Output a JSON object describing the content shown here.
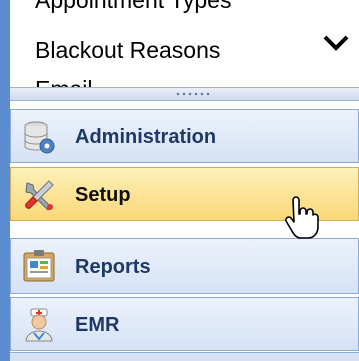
{
  "submenu": {
    "items": [
      "Appointment Types",
      "Blackout Reasons",
      "Email"
    ],
    "chevron_icon": "chevron-down-icon"
  },
  "nav": {
    "panes": [
      {
        "label": "Administration",
        "icon": "database-gear-icon"
      },
      {
        "label": "Setup",
        "icon": "wrench-screwdriver-icon",
        "active": true
      },
      {
        "label": "Reports",
        "icon": "clipboard-report-icon"
      },
      {
        "label": "EMR",
        "icon": "doctor-icon"
      }
    ]
  },
  "colors": {
    "sidebar_accent": "#5b8dd0",
    "pane_bg": "#d5e2f5",
    "active_pane_bg": "#f9d878",
    "label_text": "#1e3966"
  },
  "cursor": "hand-pointer-icon"
}
